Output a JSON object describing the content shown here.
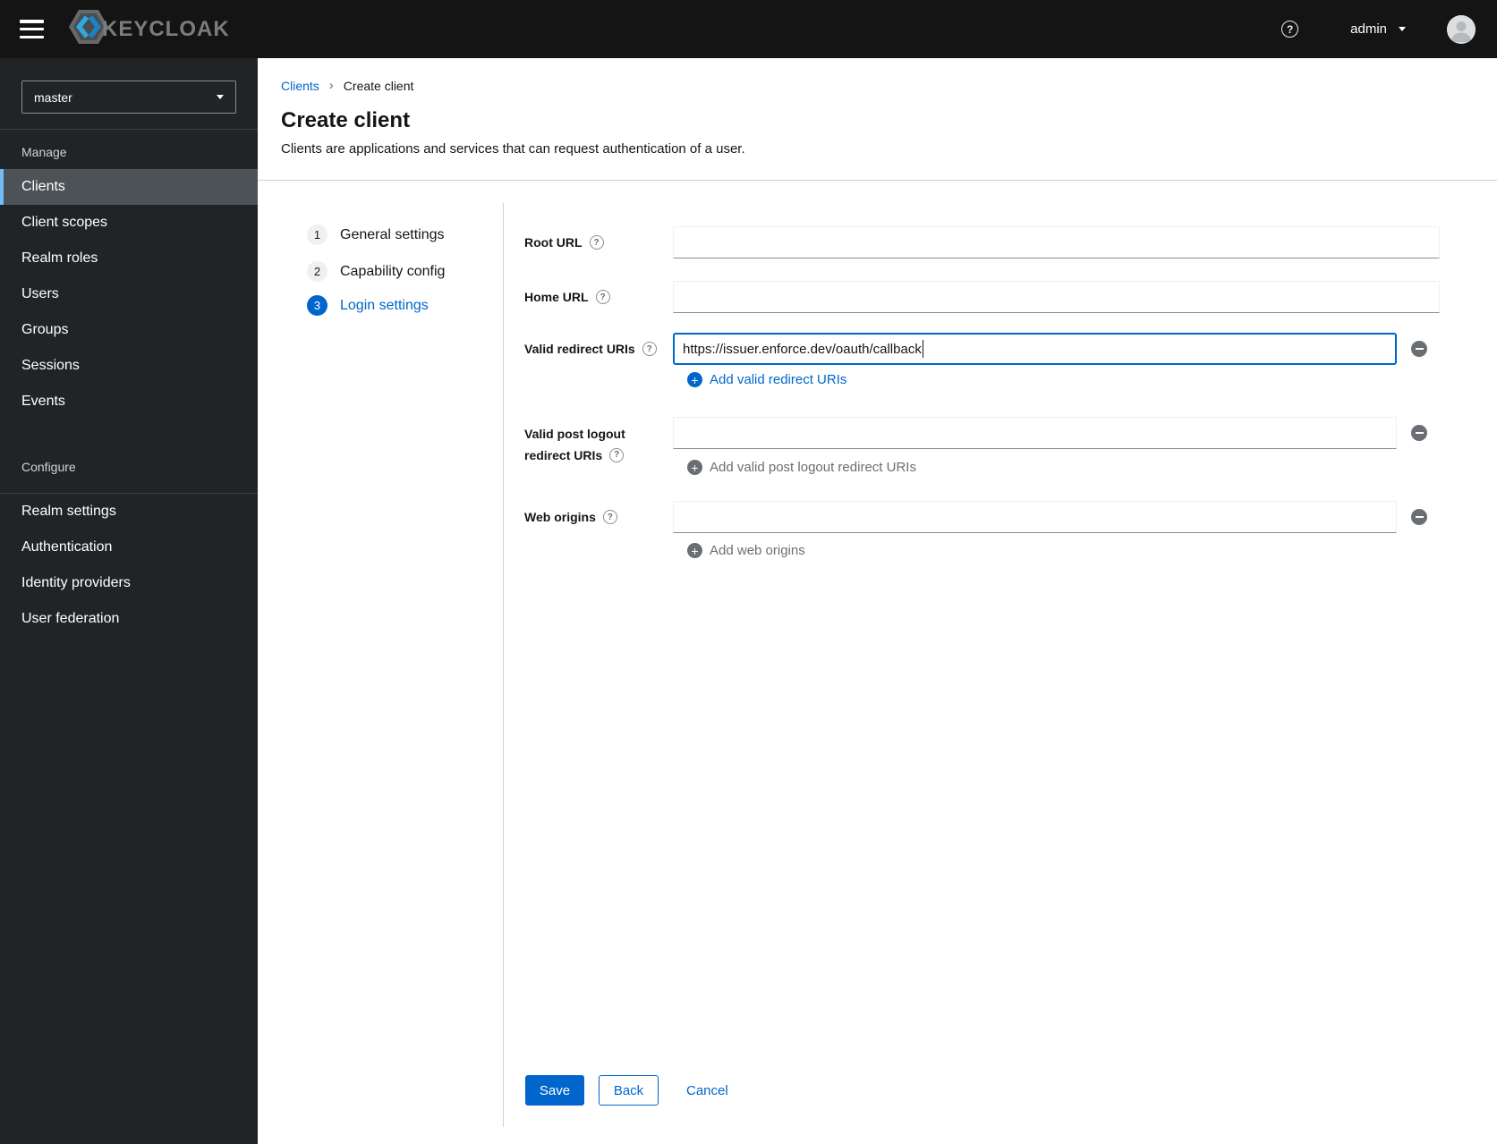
{
  "topbar": {
    "brand": "KEYCLOAK",
    "user_label": "admin"
  },
  "sidebar": {
    "realm_selector": {
      "value": "master"
    },
    "sections": [
      {
        "label": "Manage",
        "items": [
          {
            "label": "Clients",
            "active": true
          },
          {
            "label": "Client scopes",
            "active": false
          },
          {
            "label": "Realm roles",
            "active": false
          },
          {
            "label": "Users",
            "active": false
          },
          {
            "label": "Groups",
            "active": false
          },
          {
            "label": "Sessions",
            "active": false
          },
          {
            "label": "Events",
            "active": false
          }
        ]
      },
      {
        "label": "Configure",
        "items": [
          {
            "label": "Realm settings",
            "active": false
          },
          {
            "label": "Authentication",
            "active": false
          },
          {
            "label": "Identity providers",
            "active": false
          },
          {
            "label": "User federation",
            "active": false
          }
        ]
      }
    ]
  },
  "breadcrumb": {
    "parent": "Clients",
    "separator": "›",
    "current": "Create client"
  },
  "page": {
    "title": "Create client",
    "description": "Clients are applications and services that can request authentication of a user."
  },
  "wizard": {
    "steps": [
      {
        "number": "1",
        "label": "General settings",
        "active": false
      },
      {
        "number": "2",
        "label": "Capability config",
        "active": false
      },
      {
        "number": "3",
        "label": "Login settings",
        "active": true
      }
    ]
  },
  "form": {
    "root_url": {
      "label": "Root URL",
      "value": ""
    },
    "home_url": {
      "label": "Home URL",
      "value": ""
    },
    "redirect_uris": {
      "label": "Valid redirect URIs",
      "value": "https://issuer.enforce.dev/oauth/callback",
      "add_label": "Add valid redirect URIs",
      "add_enabled": true
    },
    "post_logout_uris": {
      "label_line1": "Valid post logout",
      "label_line2": "redirect URIs",
      "value": "",
      "add_label": "Add valid post logout redirect URIs",
      "add_enabled": false
    },
    "web_origins": {
      "label": "Web origins",
      "value": "",
      "add_label": "Add web origins",
      "add_enabled": false
    }
  },
  "actions": {
    "save": "Save",
    "back": "Back",
    "cancel": "Cancel"
  },
  "colors": {
    "accent_blue": "#0066cc",
    "topbar_bg": "#141414",
    "sidebar_bg": "#212427",
    "active_nav_bg": "#4d5257",
    "active_nav_border": "#73bcf7",
    "muted_gray": "#6a6e73",
    "divider_gray": "#d2d2d2",
    "input_bottom_border": "#8a8d90"
  }
}
